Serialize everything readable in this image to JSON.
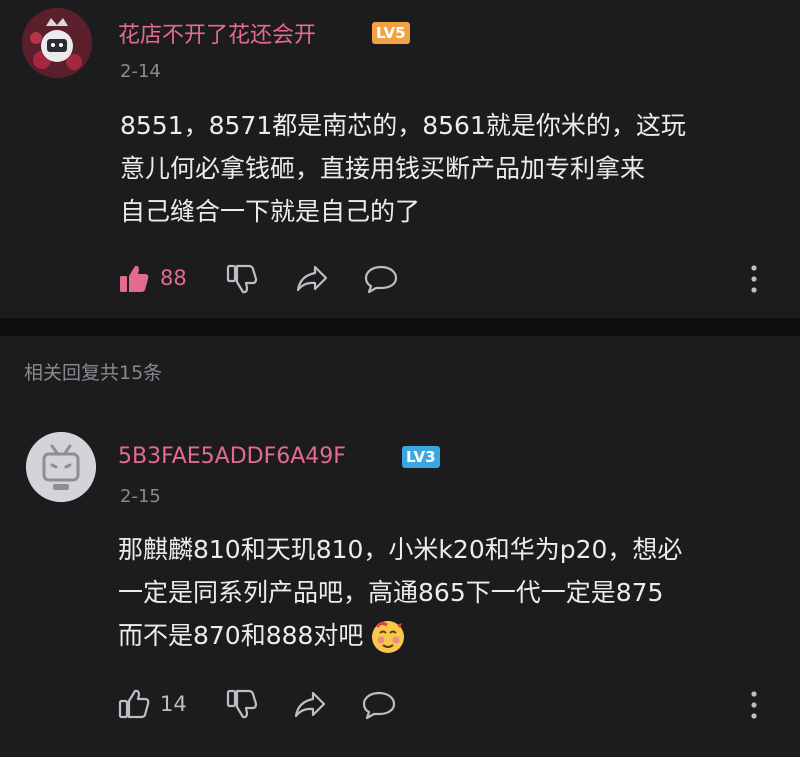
{
  "main_comment": {
    "username": "花店不开了花还会开",
    "level": "LV5",
    "date": "2-14",
    "text_lines": [
      "8551，8571都是南芯的，8561就是你米的，这玩",
      "意儿何必拿钱砸，直接用钱买断产品加专利拿来",
      "自己缝合一下就是自己的了"
    ],
    "like_count": "88",
    "liked": true
  },
  "replies_header": "相关回复共15条",
  "reply_comment": {
    "username": "5B3FAE5ADDF6A49F",
    "level": "LV3",
    "date": "2-15",
    "text_lines": [
      "那麒麟810和天玑810，小米k20和华为p20，想必",
      "一定是同系列产品吧，高通865下一代一定是875",
      "而不是870和888对吧"
    ],
    "like_count": "14",
    "liked": false
  },
  "colors": {
    "background": "#1c1c1e",
    "username": "#e36b8e",
    "liked": "#e36b8e",
    "muted": "#8a8a8e",
    "lv5": "#f0a340",
    "lv3": "#3aa7e0"
  },
  "icons": [
    "thumbs-up-icon",
    "thumbs-down-icon",
    "share-icon",
    "reply-bubble-icon",
    "more-vertical-icon",
    "emoji-icon"
  ]
}
